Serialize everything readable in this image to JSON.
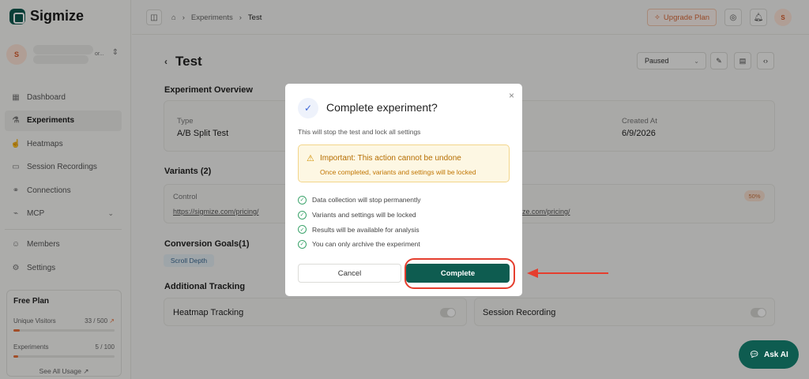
{
  "brand": {
    "name": "Sigmize"
  },
  "account": {
    "avatar_initial": "S",
    "name_truncated": "or..."
  },
  "sidebar": {
    "items": [
      {
        "label": "Dashboard",
        "icon": "grid-icon"
      },
      {
        "label": "Experiments",
        "icon": "flask-icon",
        "active": true
      },
      {
        "label": "Heatmaps",
        "icon": "hand-pointer-icon"
      },
      {
        "label": "Session Recordings",
        "icon": "video-icon"
      },
      {
        "label": "Connections",
        "icon": "link-icon"
      },
      {
        "label": "MCP",
        "icon": "plug-icon"
      },
      {
        "label": "Members",
        "icon": "users-icon"
      },
      {
        "label": "Settings",
        "icon": "gear-icon"
      }
    ],
    "plan": {
      "title": "Free Plan",
      "visitors_label": "Unique Visitors",
      "visitors_value": "33 / 500",
      "visitors_fraction": 0.066,
      "experiments_label": "Experiments",
      "experiments_value": "5 / 100",
      "experiments_fraction": 0.05,
      "usage_link": "See All Usage"
    }
  },
  "topbar": {
    "breadcrumb": [
      "Experiments",
      "Test"
    ],
    "upgrade_label": "Upgrade Plan",
    "avatar_initial": "S"
  },
  "page": {
    "title": "Test",
    "status": "Paused",
    "overview_heading": "Experiment Overview",
    "type_label": "Type",
    "type_value": "A/B Split Test",
    "created_label": "Created At",
    "created_value": "6/9/2026",
    "variants_heading": "Variants (2)",
    "control_label": "Control",
    "control_url": "https://sigmize.com/pricing/",
    "variant_url_tail": "ize.com/pricing/",
    "variant_percent": "50%",
    "goals_heading": "Conversion Goals(1)",
    "goal_chip": "Scroll Depth",
    "tracking_heading": "Additional Tracking",
    "heatmap_label": "Heatmap Tracking",
    "session_label": "Session Recording"
  },
  "ask_ai": {
    "label": "Ask AI"
  },
  "modal": {
    "title": "Complete experiment?",
    "subtitle": "This will stop the test and lock all settings",
    "warning_title": "Important: This action cannot be undone",
    "warning_desc": "Once completed, variants and settings will be locked",
    "checks": [
      "Data collection will stop permanently",
      "Variants and settings will be locked",
      "Results will be available for analysis",
      "You can only archive the experiment"
    ],
    "cancel_label": "Cancel",
    "complete_label": "Complete"
  },
  "colors": {
    "accent": "#0e5c50",
    "warning": "#b56d00",
    "annotation": "#e53e2e",
    "upgrade": "#d86a3a"
  }
}
